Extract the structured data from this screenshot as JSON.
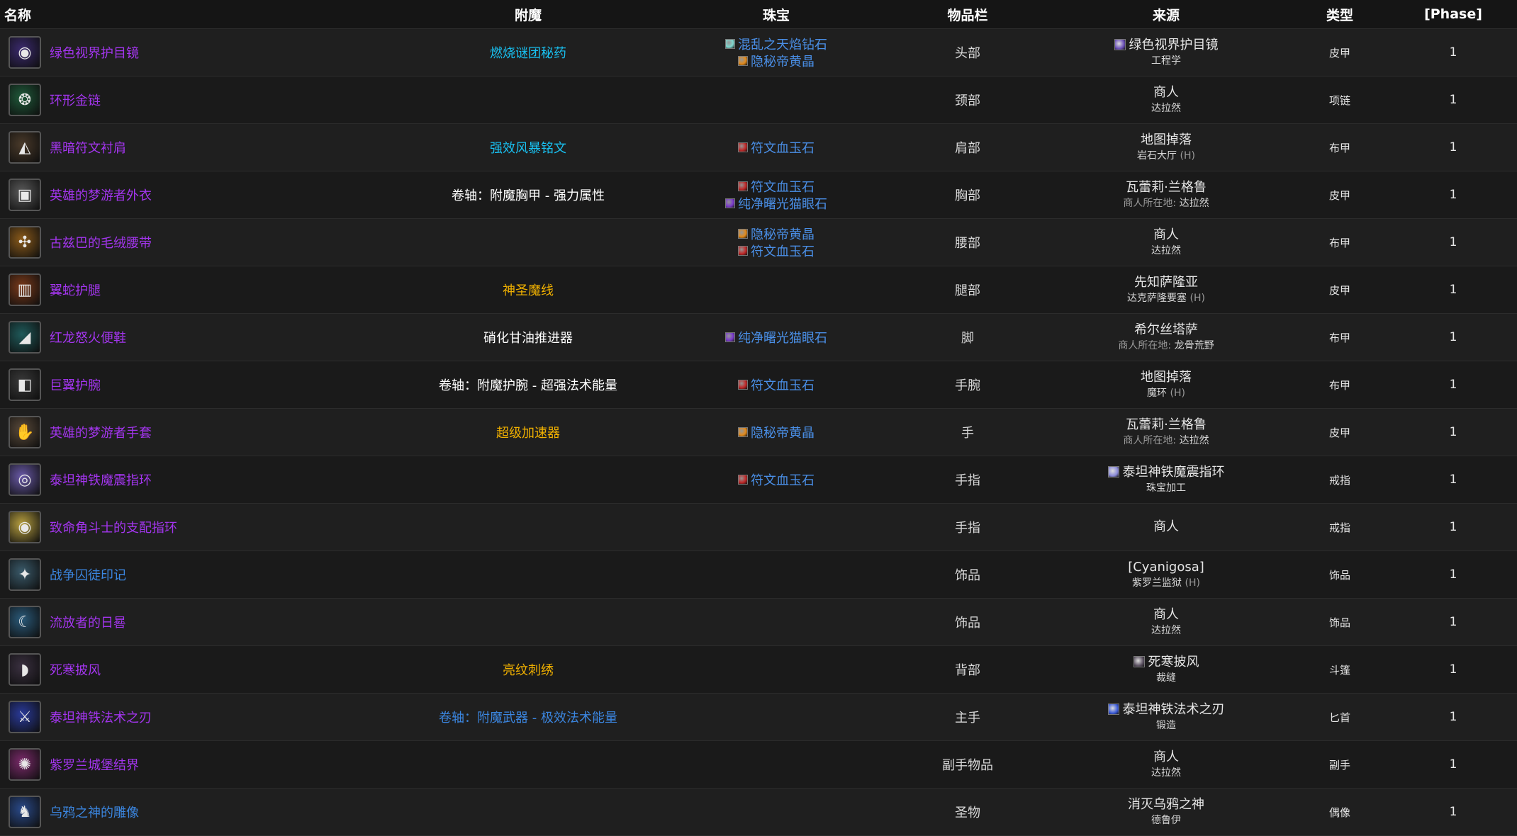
{
  "header": {
    "name": "名称",
    "enchant": "附魔",
    "gems": "珠宝",
    "slot": "物品栏",
    "source": "来源",
    "type": "类型",
    "phase": "[Phase]"
  },
  "colors": {
    "epic": "#a335ee",
    "rare": "#3b86e0",
    "enchant_blue": "#19c0f0",
    "enchant_gold": "#f0b000",
    "enchant_white": "#ffffff",
    "gem_link": "#4a8fe7"
  },
  "rows": [
    {
      "name": "绿色视界护目镜",
      "quality": "epic",
      "icon": "goggles-icon",
      "icon_bg": "#3b2a6e",
      "icon_glyph": "◉",
      "enchant": "燃烧谜团秘药",
      "enchant_color": "enchant_blue",
      "gems": [
        {
          "name": "混乱之天焰钻石",
          "icon": "meta-gem-icon",
          "icon_color": "#7fd8d0"
        },
        {
          "name": "隐秘帝黄晶",
          "icon": "orange-gem-icon",
          "icon_color": "#e28a1c"
        }
      ],
      "slot": "头部",
      "source_main": "绿色视界护目镜",
      "source_icon": "goggles-small-icon",
      "source_icon_color": "#6a4fb8",
      "source_sub": "工程学",
      "source_sub_prefix": "",
      "source_sub_suffix": "",
      "type": "皮甲",
      "phase": "1"
    },
    {
      "name": "环形金链",
      "quality": "epic",
      "icon": "necklace-icon",
      "icon_bg": "#1f5a3a",
      "icon_glyph": "❂",
      "enchant": "",
      "enchant_color": "enchant_white",
      "gems": [],
      "slot": "颈部",
      "source_main": "商人",
      "source_icon": "",
      "source_icon_color": "",
      "source_sub": "达拉然",
      "source_sub_prefix": "",
      "source_sub_suffix": "",
      "type": "项链",
      "phase": "1"
    },
    {
      "name": "黑暗符文衬肩",
      "quality": "epic",
      "icon": "shoulder-icon",
      "icon_bg": "#4a3a2a",
      "icon_glyph": "◭",
      "enchant": "强效风暴铭文",
      "enchant_color": "enchant_blue",
      "gems": [
        {
          "name": "符文血玉石",
          "icon": "red-gem-icon",
          "icon_color": "#c02828"
        }
      ],
      "slot": "肩部",
      "source_main": "地图掉落",
      "source_icon": "",
      "source_icon_color": "",
      "source_sub": "岩石大厅",
      "source_sub_prefix": "",
      "source_sub_suffix": "(H)",
      "type": "布甲",
      "phase": "1"
    },
    {
      "name": "英雄的梦游者外衣",
      "quality": "epic",
      "icon": "chest-icon",
      "icon_bg": "#5a5a5a",
      "icon_glyph": "▣",
      "enchant": "卷轴：附魔胸甲 - 强力属性",
      "enchant_color": "enchant_white",
      "gems": [
        {
          "name": "符文血玉石",
          "icon": "red-gem-icon",
          "icon_color": "#c02828"
        },
        {
          "name": "纯净曙光猫眼石",
          "icon": "purple-gem-icon",
          "icon_color": "#7a3acb"
        }
      ],
      "slot": "胸部",
      "source_main": "瓦蕾莉·兰格鲁",
      "source_icon": "",
      "source_icon_color": "",
      "source_sub": "达拉然",
      "source_sub_prefix": "商人所在地:",
      "source_sub_suffix": "",
      "type": "皮甲",
      "phase": "1"
    },
    {
      "name": "古兹巴的毛绒腰带",
      "quality": "epic",
      "icon": "belt-icon",
      "icon_bg": "#8a5a1a",
      "icon_glyph": "✣",
      "enchant": "",
      "enchant_color": "enchant_white",
      "gems": [
        {
          "name": "隐秘帝黄晶",
          "icon": "orange-gem-icon",
          "icon_color": "#e28a1c"
        },
        {
          "name": "符文血玉石",
          "icon": "red-gem-icon",
          "icon_color": "#c02828"
        }
      ],
      "slot": "腰部",
      "source_main": "商人",
      "source_icon": "",
      "source_icon_color": "",
      "source_sub": "达拉然",
      "source_sub_prefix": "",
      "source_sub_suffix": "",
      "type": "布甲",
      "phase": "1"
    },
    {
      "name": "翼蛇护腿",
      "quality": "epic",
      "icon": "legs-icon",
      "icon_bg": "#7a3a1a",
      "icon_glyph": "▥",
      "enchant": "神圣魔线",
      "enchant_color": "enchant_gold",
      "gems": [],
      "slot": "腿部",
      "source_main": "先知萨隆亚",
      "source_icon": "",
      "source_icon_color": "",
      "source_sub": "达克萨隆要塞",
      "source_sub_prefix": "",
      "source_sub_suffix": "(H)",
      "type": "皮甲",
      "phase": "1"
    },
    {
      "name": "红龙怒火便鞋",
      "quality": "epic",
      "icon": "boots-icon",
      "icon_bg": "#1f5a5a",
      "icon_glyph": "◢",
      "enchant": "硝化甘油推进器",
      "enchant_color": "enchant_white",
      "gems": [
        {
          "name": "纯净曙光猫眼石",
          "icon": "purple-gem-icon",
          "icon_color": "#7a3acb"
        }
      ],
      "slot": "脚",
      "source_main": "希尔丝塔萨",
      "source_icon": "",
      "source_icon_color": "",
      "source_sub": "龙骨荒野",
      "source_sub_prefix": "商人所在地:",
      "source_sub_suffix": "",
      "type": "布甲",
      "phase": "1"
    },
    {
      "name": "巨翼护腕",
      "quality": "epic",
      "icon": "bracer-icon",
      "icon_bg": "#3a3a3a",
      "icon_glyph": "◧",
      "enchant": "卷轴：附魔护腕 - 超强法术能量",
      "enchant_color": "enchant_white",
      "gems": [
        {
          "name": "符文血玉石",
          "icon": "red-gem-icon",
          "icon_color": "#c02828"
        }
      ],
      "slot": "手腕",
      "source_main": "地图掉落",
      "source_icon": "",
      "source_icon_color": "",
      "source_sub": "魔环",
      "source_sub_prefix": "",
      "source_sub_suffix": "(H)",
      "type": "布甲",
      "phase": "1"
    },
    {
      "name": "英雄的梦游者手套",
      "quality": "epic",
      "icon": "gloves-icon",
      "icon_bg": "#5a4a3a",
      "icon_glyph": "✋",
      "enchant": "超级加速器",
      "enchant_color": "enchant_gold",
      "gems": [
        {
          "name": "隐秘帝黄晶",
          "icon": "orange-gem-icon",
          "icon_color": "#e28a1c"
        }
      ],
      "slot": "手",
      "source_main": "瓦蕾莉·兰格鲁",
      "source_icon": "",
      "source_icon_color": "",
      "source_sub": "达拉然",
      "source_sub_prefix": "商人所在地:",
      "source_sub_suffix": "",
      "type": "皮甲",
      "phase": "1"
    },
    {
      "name": "泰坦神铁魔震指环",
      "quality": "epic",
      "icon": "ring-icon",
      "icon_bg": "#6a5aa8",
      "icon_glyph": "◎",
      "enchant": "",
      "enchant_color": "enchant_white",
      "gems": [
        {
          "name": "符文血玉石",
          "icon": "red-gem-icon",
          "icon_color": "#c02828"
        }
      ],
      "slot": "手指",
      "source_main": "泰坦神铁魔震指环",
      "source_icon": "ring-small-icon",
      "source_icon_color": "#8a8ad8",
      "source_sub": "珠宝加工",
      "source_sub_prefix": "",
      "source_sub_suffix": "",
      "type": "戒指",
      "phase": "1"
    },
    {
      "name": "致命角斗士的支配指环",
      "quality": "epic",
      "icon": "ring-icon",
      "icon_bg": "#b8a040",
      "icon_glyph": "◉",
      "enchant": "",
      "enchant_color": "enchant_white",
      "gems": [],
      "slot": "手指",
      "source_main": "商人",
      "source_icon": "",
      "source_icon_color": "",
      "source_sub": "",
      "source_sub_prefix": "",
      "source_sub_suffix": "",
      "type": "戒指",
      "phase": "1"
    },
    {
      "name": "战争囚徒印记",
      "quality": "rare",
      "icon": "trinket-icon",
      "icon_bg": "#3a5a6a",
      "icon_glyph": "✦",
      "enchant": "",
      "enchant_color": "enchant_white",
      "gems": [],
      "slot": "饰品",
      "source_main": "[Cyanigosa]",
      "source_icon": "",
      "source_icon_color": "",
      "source_sub": "紫罗兰监狱",
      "source_sub_prefix": "",
      "source_sub_suffix": "(H)",
      "type": "饰品",
      "phase": "1"
    },
    {
      "name": "流放者的日晷",
      "quality": "epic",
      "icon": "trinket-icon",
      "icon_bg": "#2a5a7a",
      "icon_glyph": "☾",
      "enchant": "",
      "enchant_color": "enchant_white",
      "gems": [],
      "slot": "饰品",
      "source_main": "商人",
      "source_icon": "",
      "source_icon_color": "",
      "source_sub": "达拉然",
      "source_sub_prefix": "",
      "source_sub_suffix": "",
      "type": "饰品",
      "phase": "1"
    },
    {
      "name": "死寒披风",
      "quality": "epic",
      "icon": "cloak-icon",
      "icon_bg": "#3a3040",
      "icon_glyph": "◗",
      "enchant": "亮纹刺绣",
      "enchant_color": "enchant_gold",
      "gems": [],
      "slot": "背部",
      "source_main": "死寒披风",
      "source_icon": "cloak-small-icon",
      "source_icon_color": "#5a5060",
      "source_sub": "裁缝",
      "source_sub_prefix": "",
      "source_sub_suffix": "",
      "type": "斗篷",
      "phase": "1"
    },
    {
      "name": "泰坦神铁法术之刃",
      "quality": "epic",
      "icon": "dagger-icon",
      "icon_bg": "#2a3a9a",
      "icon_glyph": "⚔",
      "enchant": "卷轴：附魔武器 - 极效法术能量",
      "enchant_color": "rare",
      "gems": [],
      "slot": "主手",
      "source_main": "泰坦神铁法术之刃",
      "source_icon": "dagger-small-icon",
      "source_icon_color": "#3a5ad8",
      "source_sub": "锻造",
      "source_sub_prefix": "",
      "source_sub_suffix": "",
      "type": "匕首",
      "phase": "1"
    },
    {
      "name": "紫罗兰城堡结界",
      "quality": "epic",
      "icon": "offhand-icon",
      "icon_bg": "#7a2a6a",
      "icon_glyph": "✺",
      "enchant": "",
      "enchant_color": "enchant_white",
      "gems": [],
      "slot": "副手物品",
      "source_main": "商人",
      "source_icon": "",
      "source_icon_color": "",
      "source_sub": "达拉然",
      "source_sub_prefix": "",
      "source_sub_suffix": "",
      "type": "副手",
      "phase": "1"
    },
    {
      "name": "乌鸦之神的雕像",
      "quality": "rare",
      "icon": "idol-icon",
      "icon_bg": "#2a4a8a",
      "icon_glyph": "♞",
      "enchant": "",
      "enchant_color": "enchant_white",
      "gems": [],
      "slot": "圣物",
      "source_main": "消灭乌鸦之神",
      "source_icon": "",
      "source_icon_color": "",
      "source_sub": "德鲁伊",
      "source_sub_prefix": "",
      "source_sub_suffix": "",
      "type": "偶像",
      "phase": "1"
    }
  ]
}
